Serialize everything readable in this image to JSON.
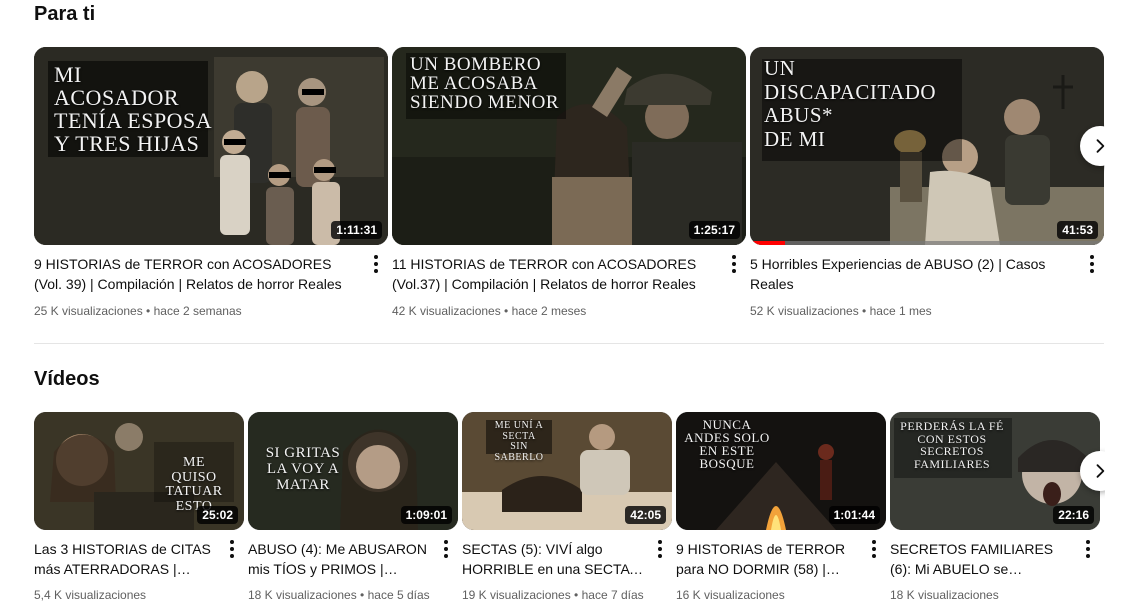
{
  "sections": {
    "para_ti": {
      "title": "Para ti",
      "videos": [
        {
          "title": "9 HISTORIAS de TERROR con ACOSADORES (Vol. 39) | Compilación | Relatos de horror Reales",
          "stats": "25 K visualizaciones • hace 2 semanas",
          "duration": "1:11:31",
          "thumb_text": "MI\nACOSADOR\nTENÍA ESPOSA\nY TRES HIJAS"
        },
        {
          "title": "11 HISTORIAS de TERROR con ACOSADORES (Vol.37) | Compilación | Relatos de horror Reales",
          "stats": "42 K visualizaciones • hace 2 meses",
          "duration": "1:25:17",
          "thumb_text": "UN BOMBERO\nME ACOSABA\nSIENDO MENOR"
        },
        {
          "title": "5 Horribles Experiencias de ABUSO (2) | Casos Reales",
          "stats": "52 K visualizaciones • hace 1 mes",
          "duration": "41:53",
          "thumb_text": "UN\nDISCAPACITADO\nABUS*\nDE MI",
          "watch_progress": 0.1
        }
      ]
    },
    "videos": {
      "title": "Vídeos",
      "videos": [
        {
          "title": "Las 3 HISTORIAS de CITAS más ATERRADORAS | Caso…",
          "stats": "5,4 K visualizaciones",
          "duration": "25:02",
          "thumb_text": "ME QUISO\nTATUAR\nESTO"
        },
        {
          "title": "ABUSO (4): Me ABUSARON mis TÍOS y PRIMOS | Casos…",
          "stats": "18 K visualizaciones • hace 5 días",
          "duration": "1:09:01",
          "thumb_text": "SI GRITAS\nLA VOY A\nMATAR"
        },
        {
          "title": "SECTAS (5): VIVÍ algo HORRIBLE en una SECTA |…",
          "stats": "19 K visualizaciones • hace 7 días",
          "duration": "42:05",
          "thumb_text": "ME UNÍ A\nSECTA\nSIN SABERLO"
        },
        {
          "title": "9 HISTORIAS de TERROR para NO DORMIR (58) |…",
          "stats": "16 K visualizaciones",
          "duration": "1:01:44",
          "thumb_text": "NUNCA\nANDES SOLO\nEN ESTE\nBOSQUE"
        },
        {
          "title": "SECRETOS FAMILIARES (6): Mi ABUELO se DESHIZO de…",
          "stats": "18 K visualizaciones",
          "duration": "22:16",
          "thumb_text": "PERDERÁS LA FÉ\nCON ESTOS\nSECRETOS\nFAMILIARES"
        }
      ]
    }
  },
  "icons": {
    "next": "chevron-right-icon",
    "more": "more-vertical-icon"
  },
  "colors": {
    "text_primary": "#0f0f0f",
    "text_secondary": "#606060",
    "progress": "#ff0000",
    "divider": "#e5e5e5"
  }
}
